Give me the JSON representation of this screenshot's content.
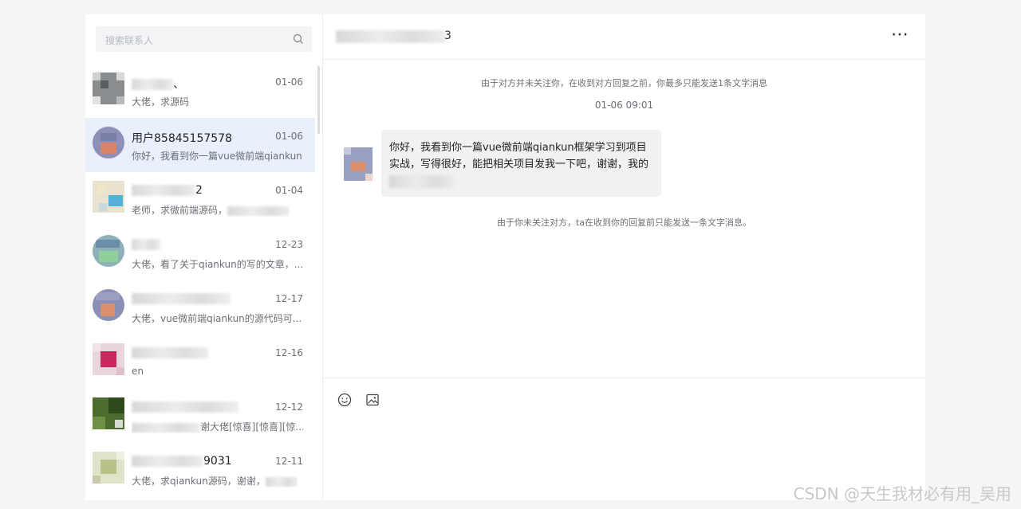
{
  "search": {
    "placeholder": "搜索联系人"
  },
  "conversations": [
    {
      "name_suffix": "、",
      "date": "01-06",
      "preview": "大佬，求源码"
    },
    {
      "name": "用户85845157578",
      "date": "01-06",
      "preview": "你好，我看到你一篇vue微前端qiankun...",
      "active": true
    },
    {
      "name_suffix": "2",
      "date": "01-04",
      "preview": "老师，求微前端源码，"
    },
    {
      "name_suffix": "",
      "date": "12-23",
      "preview": "大佬，看了关于qiankun的写的文章，..."
    },
    {
      "name_suffix": "",
      "date": "12-17",
      "preview": "大佬，vue微前端qiankun的源代码可..."
    },
    {
      "name_suffix": "",
      "date": "12-16",
      "preview": "en"
    },
    {
      "name_suffix": "",
      "date": "12-12",
      "preview": "谢大佬[惊喜][惊喜][惊..."
    },
    {
      "name_suffix": "9031",
      "date": "12-11",
      "preview": "大佬，求qiankun源码，谢谢，"
    }
  ],
  "chat": {
    "header_suffix": "3",
    "notice_top": "由于对方并未关注你，在收到对方回复之前，你最多只能发送1条文字消息",
    "timestamp": "01-06 09:01",
    "message_line1": "你好，我看到你一篇vue微前端qiankun框架学习到项目",
    "message_line2": "实战，写得很好，能把相关项目发我一下吧，谢谢，我的",
    "notice_bottom": "由于你未关注对方，ta在收到你的回复前只能发送一条文字消息。",
    "more_icon": "⋯"
  },
  "watermark": "CSDN @天生我材必有用_吴用"
}
